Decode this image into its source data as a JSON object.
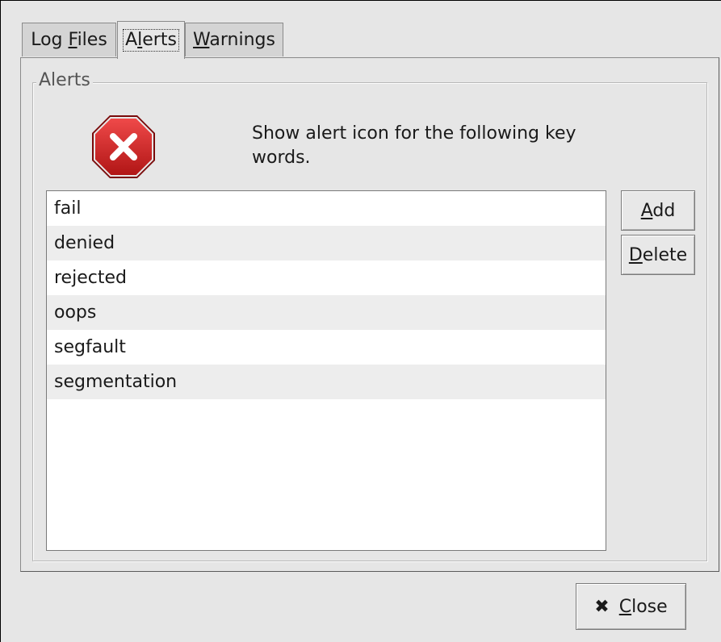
{
  "tabs": [
    {
      "pre": "Log ",
      "mnemonic": "F",
      "post": "iles",
      "active": false
    },
    {
      "pre": "A",
      "mnemonic": "l",
      "post": "erts",
      "active": true
    },
    {
      "pre": "",
      "mnemonic": "W",
      "post": "arnings",
      "active": false
    }
  ],
  "frame": {
    "title": "Alerts",
    "icon": "error-stop-icon",
    "icon_color": "#cc1f1f",
    "description": "Show alert icon for the following key words."
  },
  "keywords": [
    "fail",
    "denied",
    "rejected",
    "oops",
    "segfault",
    "segmentation"
  ],
  "buttons": {
    "add": {
      "mnemonic": "A",
      "rest": "dd"
    },
    "delete": {
      "mnemonic": "D",
      "rest": "elete"
    },
    "close": {
      "icon": "close-x-icon",
      "glyph": "✖",
      "mnemonic": "C",
      "rest": "lose"
    }
  }
}
